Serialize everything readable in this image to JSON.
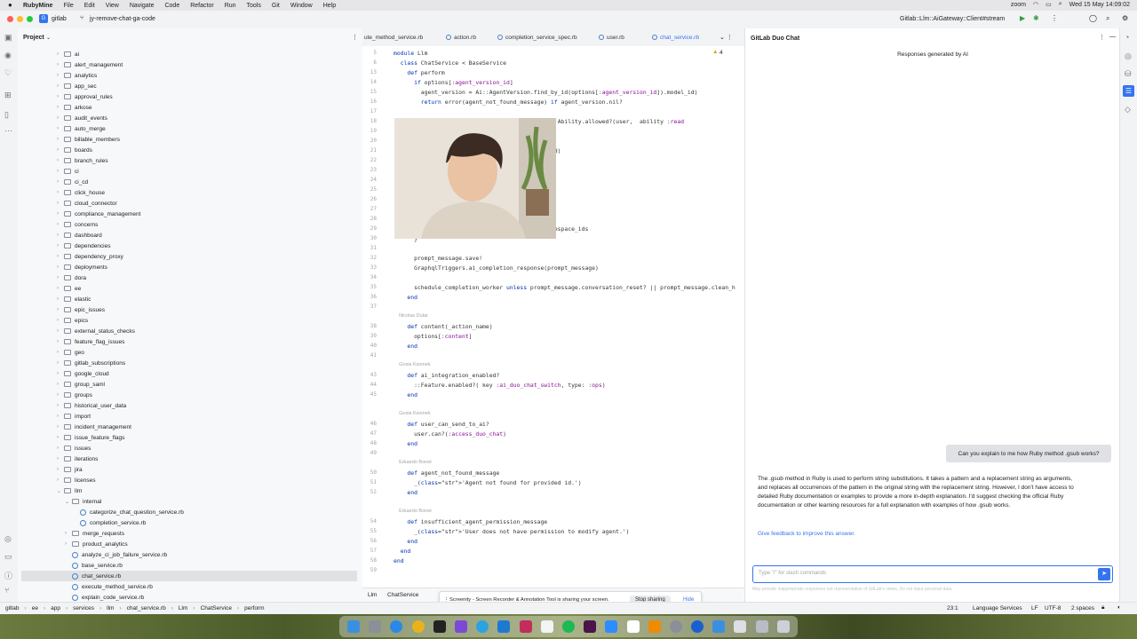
{
  "menubar": {
    "app": "RubyMine",
    "items": [
      "File",
      "Edit",
      "View",
      "Navigate",
      "Code",
      "Refactor",
      "Run",
      "Tools",
      "Git",
      "Window",
      "Help"
    ],
    "zoom": "zoom",
    "clock": "Wed 15 May 14:09:02"
  },
  "toolbar": {
    "project_badge": "G",
    "project": "gitlab",
    "branch": "jy-remove-chat-ga-code",
    "run_config": "Gitlab::Llm::AiGateway::Client#stream"
  },
  "project_panel": {
    "title": "Project",
    "items": [
      {
        "label": "ai",
        "depth": 0,
        "type": "folder"
      },
      {
        "label": "alert_management",
        "depth": 0,
        "type": "folder"
      },
      {
        "label": "analytics",
        "depth": 0,
        "type": "folder"
      },
      {
        "label": "app_sec",
        "depth": 0,
        "type": "folder"
      },
      {
        "label": "approval_rules",
        "depth": 0,
        "type": "folder"
      },
      {
        "label": "arkose",
        "depth": 0,
        "type": "folder"
      },
      {
        "label": "audit_events",
        "depth": 0,
        "type": "folder"
      },
      {
        "label": "auto_merge",
        "depth": 0,
        "type": "folder"
      },
      {
        "label": "billable_members",
        "depth": 0,
        "type": "folder"
      },
      {
        "label": "boards",
        "depth": 0,
        "type": "folder"
      },
      {
        "label": "branch_rules",
        "depth": 0,
        "type": "folder"
      },
      {
        "label": "ci",
        "depth": 0,
        "type": "folder"
      },
      {
        "label": "ci_cd",
        "depth": 0,
        "type": "folder"
      },
      {
        "label": "click_house",
        "depth": 0,
        "type": "folder"
      },
      {
        "label": "cloud_connector",
        "depth": 0,
        "type": "folder"
      },
      {
        "label": "compliance_management",
        "depth": 0,
        "type": "folder"
      },
      {
        "label": "concerns",
        "depth": 0,
        "type": "folder"
      },
      {
        "label": "dashboard",
        "depth": 0,
        "type": "folder"
      },
      {
        "label": "dependencies",
        "depth": 0,
        "type": "folder"
      },
      {
        "label": "dependency_proxy",
        "depth": 0,
        "type": "folder"
      },
      {
        "label": "deployments",
        "depth": 0,
        "type": "folder"
      },
      {
        "label": "dora",
        "depth": 0,
        "type": "folder"
      },
      {
        "label": "ee",
        "depth": 0,
        "type": "folder"
      },
      {
        "label": "elastic",
        "depth": 0,
        "type": "folder"
      },
      {
        "label": "epic_issues",
        "depth": 0,
        "type": "folder"
      },
      {
        "label": "epics",
        "depth": 0,
        "type": "folder"
      },
      {
        "label": "external_status_checks",
        "depth": 0,
        "type": "folder"
      },
      {
        "label": "feature_flag_issues",
        "depth": 0,
        "type": "folder"
      },
      {
        "label": "geo",
        "depth": 0,
        "type": "folder"
      },
      {
        "label": "gitlab_subscriptions",
        "depth": 0,
        "type": "folder"
      },
      {
        "label": "google_cloud",
        "depth": 0,
        "type": "folder"
      },
      {
        "label": "group_saml",
        "depth": 0,
        "type": "folder"
      },
      {
        "label": "groups",
        "depth": 0,
        "type": "folder"
      },
      {
        "label": "historical_user_data",
        "depth": 0,
        "type": "folder"
      },
      {
        "label": "import",
        "depth": 0,
        "type": "folder"
      },
      {
        "label": "incident_management",
        "depth": 0,
        "type": "folder"
      },
      {
        "label": "issue_feature_flags",
        "depth": 0,
        "type": "folder"
      },
      {
        "label": "issues",
        "depth": 0,
        "type": "folder"
      },
      {
        "label": "iterations",
        "depth": 0,
        "type": "folder"
      },
      {
        "label": "jira",
        "depth": 0,
        "type": "folder"
      },
      {
        "label": "licenses",
        "depth": 0,
        "type": "folder"
      },
      {
        "label": "llm",
        "depth": 0,
        "type": "folder-open"
      },
      {
        "label": "internal",
        "depth": 1,
        "type": "folder-open"
      },
      {
        "label": "categorize_chat_question_service.rb",
        "depth": 2,
        "type": "file"
      },
      {
        "label": "completion_service.rb",
        "depth": 2,
        "type": "file"
      },
      {
        "label": "merge_requests",
        "depth": 1,
        "type": "folder"
      },
      {
        "label": "product_analytics",
        "depth": 1,
        "type": "folder"
      },
      {
        "label": "analyze_ci_job_failure_service.rb",
        "depth": 1,
        "type": "file"
      },
      {
        "label": "base_service.rb",
        "depth": 1,
        "type": "file"
      },
      {
        "label": "chat_service.rb",
        "depth": 1,
        "type": "file",
        "selected": true
      },
      {
        "label": "execute_method_service.rb",
        "depth": 1,
        "type": "file"
      },
      {
        "label": "explain_code_service.rb",
        "depth": 1,
        "type": "file"
      }
    ]
  },
  "editor": {
    "tabs": [
      {
        "label": "ute_method_service.rb",
        "active": false
      },
      {
        "label": "action.rb",
        "active": false
      },
      {
        "label": "completion_service_spec.rb",
        "active": false
      },
      {
        "label": "user.rb",
        "active": false
      },
      {
        "label": "chat_service.rb",
        "active": true
      }
    ],
    "warning_count": "4",
    "lines": [
      {
        "n": "5",
        "t": "module Llm"
      },
      {
        "n": "6",
        "t": "  class ChatService < BaseService"
      },
      {
        "n": "13",
        "t": "    def perform"
      },
      {
        "n": "14",
        "t": "      if options[:agent_version_id]"
      },
      {
        "n": "15",
        "t": "        agent_version = Ai::AgentVersion.find_by_id(options[:agent_version_id]).model_id)"
      },
      {
        "n": "16",
        "t": "        return error(agent_not_found_message) if agent_version.nil?"
      },
      {
        "n": "17",
        "t": ""
      },
      {
        "n": "18",
        "t": "                            ion_message) unless Ability.allowed?(user,  ability :read"
      },
      {
        "n": "19",
        "t": ""
      },
      {
        "n": "20",
        "t": ""
      },
      {
        "n": "21",
        "t": "                            id: agent_version.id)"
      },
      {
        "n": "22",
        "t": ""
      },
      {
        "n": "23",
        "t": ""
      },
      {
        "n": "24",
        "t": ""
      },
      {
        "n": "25",
        "t": ""
      },
      {
        "n": "26",
        "t": ""
      },
      {
        "n": "27",
        "t": ""
      },
      {
        "n": "28",
        "t": ""
      },
      {
        "n": "29",
        "t": "                            ai_chat_enabled_namespace_ids"
      },
      {
        "n": "30",
        "t": "      }"
      },
      {
        "n": "31",
        "t": ""
      },
      {
        "n": "32",
        "t": "      prompt_message.save!"
      },
      {
        "n": "33",
        "t": "      GraphqlTriggers.ai_completion_response(prompt_message)"
      },
      {
        "n": "34",
        "t": ""
      },
      {
        "n": "35",
        "t": "      schedule_completion_worker unless prompt_message.conversation_reset? || prompt_message.clean_h"
      },
      {
        "n": "36",
        "t": "    end"
      },
      {
        "n": "37",
        "t": ""
      },
      {
        "n": "",
        "t": "    Nicolas Dular",
        "c": true
      },
      {
        "n": "38",
        "t": "    def content(_action_name)"
      },
      {
        "n": "39",
        "t": "      options[:content]"
      },
      {
        "n": "40",
        "t": "    end"
      },
      {
        "n": "41",
        "t": ""
      },
      {
        "n": "",
        "t": "    Gosia Ksionek",
        "c": true
      },
      {
        "n": "43",
        "t": "    def ai_integration_enabled?"
      },
      {
        "n": "44",
        "t": "      ::Feature.enabled?( key :ai_duo_chat_switch, type: :ops)"
      },
      {
        "n": "45",
        "t": "    end"
      },
      {
        "n": "",
        "t": ""
      },
      {
        "n": "",
        "t": "    Gosia Ksionek",
        "c": true
      },
      {
        "n": "46",
        "t": "    def user_can_send_to_ai?"
      },
      {
        "n": "47",
        "t": "      user.can?(:access_duo_chat)"
      },
      {
        "n": "48",
        "t": "    end"
      },
      {
        "n": "49",
        "t": ""
      },
      {
        "n": "",
        "t": "    Eduardo Bonet",
        "c": true
      },
      {
        "n": "50",
        "t": "    def agent_not_found_message"
      },
      {
        "n": "51",
        "t": "      _('Agent not found for provided id.')"
      },
      {
        "n": "52",
        "t": "    end"
      },
      {
        "n": "",
        "t": ""
      },
      {
        "n": "",
        "t": "    Eduardo Bonet",
        "c": true
      },
      {
        "n": "54",
        "t": "    def insufficient_agent_permission_message"
      },
      {
        "n": "55",
        "t": "      _('User does not have permission to modify agent.')"
      },
      {
        "n": "56",
        "t": "    end"
      },
      {
        "n": "57",
        "t": "  end"
      },
      {
        "n": "58",
        "t": "end"
      },
      {
        "n": "59",
        "t": ""
      }
    ],
    "breadcrumb": [
      "Llm",
      "ChatService"
    ]
  },
  "sharing": {
    "message": "Screenity - Screen Recorder & Annotation Tool is sharing your screen.",
    "stop": "Stop sharing",
    "hide": "Hide"
  },
  "chat": {
    "title": "GitLab Duo Chat",
    "subtitle": "Responses generated by AI",
    "user_message": "Can you explain to me how Ruby method .gsub works?",
    "answer": "The .gsub method in Ruby is used to perform string substitutions. It takes a pattern and a replacement string as arguments, and replaces all occurrences of the pattern in the original string with the replacement string. However, I don't have access to detailed Ruby documentation or examples to provide a more in-depth explanation. I'd suggest checking the official Ruby documentation or other learning resources for a full explanation with examples of how .gsub works.",
    "feedback": "Give feedback to improve this answer.",
    "input_placeholder": "Type \"/\" for slash commands",
    "disclaimer": "May provide inappropriate responses not representative of GitLab's views. Do not input personal data."
  },
  "statusbar": {
    "path": [
      "gitlab",
      "ee",
      "app",
      "services",
      "llm",
      "chat_service.rb",
      "Llm",
      "ChatService",
      "perform"
    ],
    "position": "23:1",
    "lang": "Language Services",
    "eol": "LF",
    "encoding": "UTF-8",
    "indent": "2 spaces"
  },
  "colors": {
    "accent": "#3574f0",
    "user_bubble": "#dfe1e5",
    "send_button": "#3574f0"
  }
}
